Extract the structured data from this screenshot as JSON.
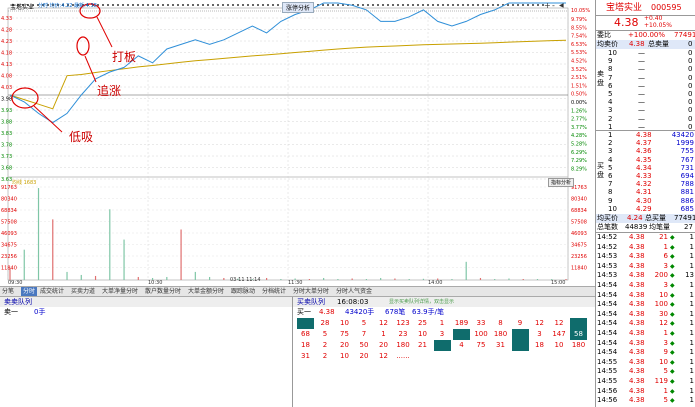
{
  "chart": {
    "stock_title": "宝塔实业",
    "subtitle": "分时 均价:4.22 最新:4.38",
    "button_analysis": "涨停分析",
    "button_index": "指标分析",
    "pct_top": "10.05%",
    "y_price_labels": [
      "4.33",
      "4.28",
      "4.23",
      "4.18",
      "4.13",
      "4.08",
      "4.03",
      "3.98",
      "3.93",
      "3.88",
      "3.83",
      "3.78",
      "3.73",
      "3.68",
      "3.63"
    ],
    "y_pct_labels": [
      "9.79%",
      "8.55%",
      "7.54%",
      "6.53%",
      "5.53%",
      "4.52%",
      "3.52%",
      "2.51%",
      "1.51%",
      "0.50%",
      "0.00%",
      "1.26%",
      "2.77%",
      "3.77%",
      "4.28%",
      "5.28%",
      "6.29%",
      "7.29%",
      "8.29%"
    ],
    "vol_labels": [
      "91763",
      "80340",
      "68834",
      "57508",
      "46093",
      "34675",
      "23256",
      "11840"
    ],
    "vol_label_top": "均线 1683",
    "x_labels": [
      "09:30",
      "10:30",
      "11:30",
      "13:00",
      "14:00",
      "15:00"
    ],
    "mid_time": "03-11 11:14",
    "annotations": {
      "daban": "打板",
      "zhuizhang": "追涨",
      "dixi": "低吸"
    },
    "zoom_icons": [
      "+",
      "-",
      "◀"
    ]
  },
  "series": {
    "price": [
      3.98,
      3.95,
      3.9,
      3.86,
      3.9,
      3.98,
      4.05,
      4.08,
      4.1,
      4.15,
      4.12,
      4.18,
      4.2,
      4.22,
      4.2,
      4.22,
      4.25,
      4.28,
      4.25,
      4.3,
      4.33,
      4.35,
      4.38,
      4.38,
      4.37,
      4.35,
      4.3,
      4.3,
      4.32,
      4.35,
      4.3,
      4.28,
      4.3,
      4.33,
      4.35,
      4.38,
      4.38,
      4.38,
      4.38,
      4.38
    ],
    "volume": [
      12000,
      30000,
      91000,
      60000,
      8000,
      5000,
      4000,
      70000,
      40000,
      3000,
      2000,
      3000,
      50000,
      8000,
      3000,
      2000,
      1500,
      1000,
      2000,
      1000,
      1500,
      1000,
      2000,
      1000,
      1500,
      1000,
      2000,
      1500,
      1000,
      1200,
      1500,
      1000,
      18000,
      2000,
      1000,
      1500,
      1000,
      1000,
      1000,
      1000
    ]
  },
  "header": {
    "name": "宝塔实业",
    "code": "000595",
    "price": "4.38",
    "change": "+0.40",
    "change_pct": "+10.05%",
    "weibi_label": "委比",
    "weibi_value": "+100.00%",
    "weibi_right": "77491",
    "junmai_label": "均卖价",
    "junmai_value": "4.38",
    "zongmai_label": "总卖量",
    "zongmai_value": "0"
  },
  "sell_levels": [
    {
      "level": "10",
      "price": "—",
      "vol": "0"
    },
    {
      "level": "9",
      "price": "—",
      "vol": "0"
    },
    {
      "level": "8",
      "price": "—",
      "vol": "0"
    },
    {
      "level": "7",
      "price": "—",
      "vol": "0"
    },
    {
      "level": "6",
      "price": "—",
      "vol": "0"
    },
    {
      "level": "5",
      "price": "—",
      "vol": "0"
    },
    {
      "level": "4",
      "price": "—",
      "vol": "0"
    },
    {
      "level": "3",
      "price": "—",
      "vol": "0"
    },
    {
      "level": "2",
      "price": "—",
      "vol": "0"
    },
    {
      "level": "1",
      "price": "—",
      "vol": "0"
    }
  ],
  "buy_levels": [
    {
      "level": "1",
      "price": "4.38",
      "vol": "43420"
    },
    {
      "level": "2",
      "price": "4.37",
      "vol": "1999"
    },
    {
      "level": "3",
      "price": "4.36",
      "vol": "755"
    },
    {
      "level": "4",
      "price": "4.35",
      "vol": "767"
    },
    {
      "level": "5",
      "price": "4.34",
      "vol": "731"
    },
    {
      "level": "6",
      "price": "4.33",
      "vol": "694"
    },
    {
      "level": "7",
      "price": "4.32",
      "vol": "788"
    },
    {
      "level": "8",
      "price": "4.31",
      "vol": "881"
    },
    {
      "level": "9",
      "price": "4.30",
      "vol": "886"
    },
    {
      "level": "10",
      "price": "4.29",
      "vol": "685"
    }
  ],
  "side_labels": {
    "sell": "卖盘",
    "buy": "买盘"
  },
  "summary": {
    "junmai_b_label": "均买价",
    "junmai_b_value": "4.24",
    "zongmai_b_label": "总买量",
    "zongmai_b_value": "77491",
    "bishu_label": "总笔数",
    "bishu_value": "44839",
    "junbi_label": "均笔量",
    "junbi_value": "27"
  },
  "ticks": [
    {
      "time": "14:52",
      "price": "4.38",
      "vol": "21",
      "dir": "◆",
      "n": "1"
    },
    {
      "time": "14:52",
      "price": "4.38",
      "vol": "1",
      "dir": "◆",
      "n": "1"
    },
    {
      "time": "14:53",
      "price": "4.38",
      "vol": "6",
      "dir": "◆",
      "n": "1"
    },
    {
      "time": "14:53",
      "price": "4.38",
      "vol": "3",
      "dir": "◆",
      "n": "1"
    },
    {
      "time": "14:53",
      "price": "4.38",
      "vol": "200",
      "dir": "◆",
      "n": "13"
    },
    {
      "time": "14:54",
      "price": "4.38",
      "vol": "3",
      "dir": "◆",
      "n": "1"
    },
    {
      "time": "14:54",
      "price": "4.38",
      "vol": "10",
      "dir": "◆",
      "n": "1"
    },
    {
      "time": "14:54",
      "price": "4.38",
      "vol": "100",
      "dir": "◆",
      "n": "1"
    },
    {
      "time": "14:54",
      "price": "4.38",
      "vol": "30",
      "dir": "◆",
      "n": "1"
    },
    {
      "time": "14:54",
      "price": "4.38",
      "vol": "12",
      "dir": "◆",
      "n": "1"
    },
    {
      "time": "14:54",
      "price": "4.38",
      "vol": "1",
      "dir": "◆",
      "n": "1"
    },
    {
      "time": "14:54",
      "price": "4.38",
      "vol": "3",
      "dir": "◆",
      "n": "1"
    },
    {
      "time": "14:54",
      "price": "4.38",
      "vol": "9",
      "dir": "◆",
      "n": "1"
    },
    {
      "time": "14:55",
      "price": "4.38",
      "vol": "10",
      "dir": "◆",
      "n": "1"
    },
    {
      "time": "14:55",
      "price": "4.38",
      "vol": "5",
      "dir": "◆",
      "n": "1"
    },
    {
      "time": "14:55",
      "price": "4.38",
      "vol": "119",
      "dir": "◆",
      "n": "1"
    },
    {
      "time": "14:56",
      "price": "4.38",
      "vol": "1",
      "dir": "◆",
      "n": "1"
    },
    {
      "time": "14:56",
      "price": "4.38",
      "vol": "5",
      "dir": "◆",
      "n": "1"
    }
  ],
  "tabs": [
    "分笔",
    "分时",
    "成交统计",
    "买卖力道",
    "大单净量分时",
    "散户数量分时",
    "大单金额分时",
    "跟踪脉动",
    "分档统计",
    "分时大单分时",
    "分时人气资金"
  ],
  "sell_queue": {
    "title": "卖卖队列",
    "row_label": "卖一",
    "row_value": "0手"
  },
  "buy_queue": {
    "title": "买卖队列",
    "time": "16:08:03",
    "note": "显示买卖队列详情，双击显示",
    "row_label": "买一",
    "price": "4.38",
    "shou": "43420手",
    "bi": "678笔",
    "avg": "63.9手/笔",
    "rows": [
      [
        "",
        "28",
        "10",
        "5",
        "12",
        "123",
        "25",
        "1",
        "189",
        "33",
        "8",
        "9",
        "12",
        "12",
        ""
      ],
      [
        "68",
        "5",
        "75",
        "7",
        "1",
        "23",
        "10",
        "3",
        "",
        "100",
        "180",
        "",
        "3",
        "147",
        "58"
      ],
      [
        "18",
        "2",
        "20",
        "50",
        "20",
        "180",
        "21",
        "",
        "4",
        "75",
        "31",
        "",
        "18",
        "10",
        "180"
      ],
      [
        "31",
        "2",
        "10",
        "20",
        "12",
        "......",
        "",
        "",
        "",
        "",
        "",
        "",
        "",
        "",
        ""
      ]
    ],
    "box_cells": [
      [
        0,
        0
      ],
      [
        1,
        8
      ],
      [
        1,
        11
      ],
      [
        2,
        7
      ],
      [
        2,
        11
      ],
      [
        0,
        14
      ],
      [
        1,
        14
      ]
    ]
  },
  "colors": {
    "price_line": "#2f8fd8",
    "avg_line": "#c8a000",
    "red": "#e00000",
    "green": "#008800",
    "vol_bar": "#7fc6a6",
    "queue_box": "#0f6c6c"
  }
}
